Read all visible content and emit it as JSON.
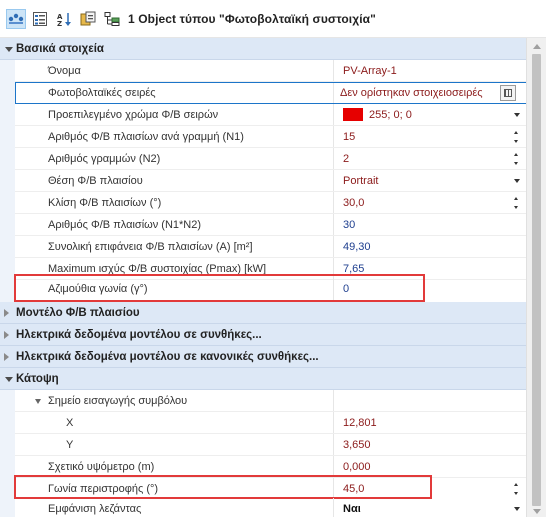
{
  "toolbar": {
    "title": "1 Object  τύπου \"Φωτοβολταϊκή συστοιχία\"",
    "buttons": [
      "categorized-view-icon",
      "properties-view-icon",
      "sort-az-icon",
      "property-pages-icon",
      "object-tree-icon"
    ]
  },
  "colors": {
    "category_bg": "#dde8f6",
    "accent_border": "#1c75c9",
    "highlight": "#e23a3a",
    "swatch": "#e60000"
  },
  "categories": {
    "basic": "Βασικά στοιχεία",
    "module_model": "Μοντέλο Φ/Β πλαισίου",
    "electrical_cond": "Ηλεκτρικά δεδομένα μοντέλου σε συνθήκες...",
    "electrical_norm": "Ηλεκτρικά δεδομένα μοντέλου σε κανονικές συνθήκες...",
    "plan": "Κάτοψη"
  },
  "properties": {
    "name": {
      "label": "Όνομα",
      "value": "PV-Array-1"
    },
    "strings": {
      "label": "Φωτοβολταϊκές σειρές",
      "value": "Δεν ορίστηκαν στοιχειοσειρές"
    },
    "color": {
      "label": "Προεπιλεγμένο χρώμα Φ/Β σειρών",
      "value": "255; 0; 0"
    },
    "n1": {
      "label": "Αριθμός Φ/Β πλαισίων ανά γραμμή (N1)",
      "value": "15"
    },
    "n2": {
      "label": "Αριθμός γραμμών (N2)",
      "value": "2"
    },
    "orientation": {
      "label": "Θέση Φ/Β πλαισίου",
      "value": "Portrait"
    },
    "tilt": {
      "label": "Κλίση Φ/Β πλαισίων (°)",
      "value": "30,0"
    },
    "total": {
      "label": "Αριθμός Φ/Β πλαισίων (N1*N2)",
      "value": "30"
    },
    "area": {
      "label": "Συνολική επιφάνεια Φ/Β πλαισίων (A) [m²]",
      "value": "49,30"
    },
    "pmax": {
      "label": "Maximum ισχύς Φ/Β συστοιχίας (Pmax) [kW]",
      "value": "7,65"
    },
    "azimuth": {
      "label": "Αζιμούθια γωνία (γ°)",
      "value": "0"
    },
    "insertion_point": {
      "label": "Σημείο εισαγωγής συμβόλου"
    },
    "x": {
      "label": "X",
      "value": "12,801"
    },
    "y": {
      "label": "Y",
      "value": "3,650"
    },
    "elevation": {
      "label": "Σχετικό υψόμετρο (m)",
      "value": "0,000"
    },
    "rotation": {
      "label": "Γωνία περιστροφής (°)",
      "value": "45,0"
    },
    "legend": {
      "label": "Εμφάνιση λεζάντας",
      "value": "Ναι"
    }
  }
}
